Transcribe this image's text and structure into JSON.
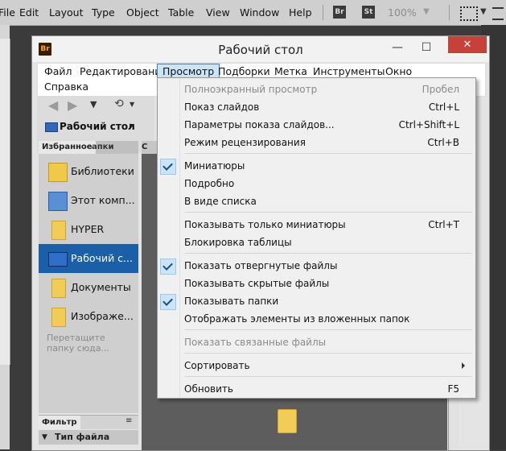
{
  "host": {
    "menu": [
      "File",
      "Edit",
      "Layout",
      "Type",
      "Object",
      "Table",
      "View",
      "Window",
      "Help"
    ],
    "badges": [
      "Br",
      "St"
    ],
    "zoom": "100%"
  },
  "window": {
    "app_badge": "Br",
    "title": "Рабочий стол",
    "minimize": "—",
    "maximize": "☐",
    "close": "✕"
  },
  "menubar": {
    "items": [
      "Файл",
      "Редактирование",
      "Просмотр",
      "Подборки",
      "Метка",
      "Инструменты",
      "Окно",
      "Справка"
    ],
    "active": "Просмотр"
  },
  "toolbar": {
    "breadcrumb": "Рабочий стол",
    "breadcrumb_arrow": "›"
  },
  "panels": {
    "favorites_tab": "Избранное",
    "folders_tab": "апки",
    "content_tab": "С",
    "favorites": [
      {
        "label": "Библиотеки",
        "icon": "libraries-icon"
      },
      {
        "label": "Этот комп...",
        "icon": "computer-icon"
      },
      {
        "label": "HYPER",
        "icon": "folder-icon"
      },
      {
        "label": "Рабочий с...",
        "icon": "desktop-icon",
        "selected": true
      },
      {
        "label": "Документы",
        "icon": "documents-icon"
      },
      {
        "label": "Изображе...",
        "icon": "pictures-icon"
      }
    ],
    "drop_hint": "Перетащите папку сюда...",
    "filter_tab": "Фильтр",
    "filter_row": "Тип файла"
  },
  "view_menu": {
    "items": [
      {
        "label": "Полноэкранный просмотр",
        "shortcut": "Пробел",
        "disabled": true
      },
      {
        "label": "Показ слайдов",
        "shortcut": "Ctrl+L"
      },
      {
        "label": "Параметры показа слайдов...",
        "shortcut": "Ctrl+Shift+L"
      },
      {
        "label": "Режим рецензирования",
        "shortcut": "Ctrl+B"
      },
      {
        "label": "Миниатюры",
        "checked": true
      },
      {
        "label": "Подробно"
      },
      {
        "label": "В виде списка"
      },
      {
        "label": "Показывать только миниатюры",
        "shortcut": "Ctrl+T"
      },
      {
        "label": "Блокировка таблицы"
      },
      {
        "label": "Показать отвергнутые файлы",
        "checked": true
      },
      {
        "label": "Показывать скрытые файлы"
      },
      {
        "label": "Показывать папки",
        "checked": true
      },
      {
        "label": "Отображать элементы из вложенных папок"
      },
      {
        "label": "Показать связанные файлы",
        "disabled": true
      },
      {
        "label": "Сортировать",
        "submenu": true
      },
      {
        "label": "Обновить",
        "shortcut": "F5"
      }
    ]
  },
  "colors": {
    "accent": "#2d87d6",
    "selection": "#1a5fa8",
    "close": "#c7413a"
  }
}
